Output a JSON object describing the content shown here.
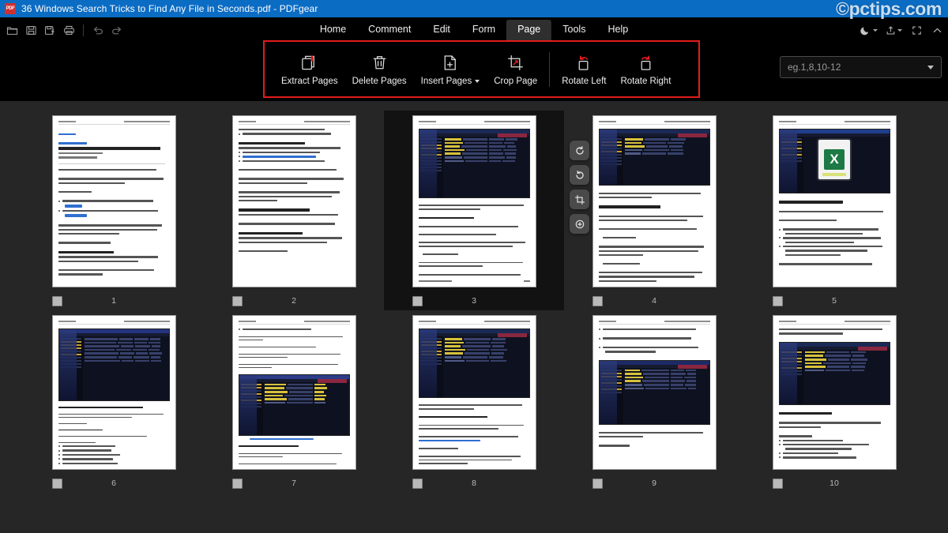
{
  "window": {
    "title": "36 Windows Search Tricks to Find Any File in Seconds.pdf - PDFgear",
    "app_icon": "pdf-file-icon",
    "titlebar_color": "#0b6cc4"
  },
  "watermark": {
    "text": "©pctips.com"
  },
  "quick_access": {
    "items": [
      {
        "name": "open-file-icon",
        "label": "Open"
      },
      {
        "name": "save-icon",
        "label": "Save"
      },
      {
        "name": "save-as-icon",
        "label": "Save As"
      },
      {
        "name": "print-icon",
        "label": "Print"
      },
      {
        "name": "undo-icon",
        "label": "Undo"
      },
      {
        "name": "redo-icon",
        "label": "Redo"
      }
    ]
  },
  "menu": {
    "active": "Page",
    "items": [
      {
        "label": "Home"
      },
      {
        "label": "Comment"
      },
      {
        "label": "Edit"
      },
      {
        "label": "Form"
      },
      {
        "label": "Page"
      },
      {
        "label": "Tools"
      },
      {
        "label": "Help"
      }
    ]
  },
  "window_controls": {
    "items": [
      {
        "name": "dark-mode-moon-icon",
        "label": "Dark Mode"
      },
      {
        "name": "share-upload-icon",
        "label": "Share"
      },
      {
        "name": "fullscreen-icon",
        "label": "Fullscreen"
      },
      {
        "name": "collapse-ribbon-chevron-up-icon",
        "label": "Collapse Ribbon"
      }
    ]
  },
  "ribbon": {
    "highlight_color": "#e31c1c",
    "buttons": [
      {
        "label": "Extract Pages",
        "icon": "extract-pages-icon",
        "caret": false
      },
      {
        "label": "Delete Pages",
        "icon": "delete-pages-trash-icon",
        "caret": false
      },
      {
        "label": "Insert Pages",
        "icon": "insert-pages-icon",
        "caret": true
      },
      {
        "label": "Crop Page",
        "icon": "crop-page-icon",
        "caret": false
      },
      {
        "label": "Rotate Left",
        "icon": "rotate-left-icon",
        "caret": false
      },
      {
        "label": "Rotate Right",
        "icon": "rotate-right-icon",
        "caret": false
      }
    ]
  },
  "page_range": {
    "placeholder": "eg.1,8,10-12",
    "value": "",
    "dropdown_icon": "chevron-down-icon"
  },
  "thumbnail_actions": [
    {
      "name": "rotate-left-action-icon",
      "label": "Rotate Left"
    },
    {
      "name": "rotate-right-action-icon",
      "label": "Rotate Right"
    },
    {
      "name": "crop-action-icon",
      "label": "Crop"
    },
    {
      "name": "zoom-in-action-icon",
      "label": "Zoom In"
    }
  ],
  "thumbnails": {
    "selected_page": 3,
    "pages": [
      {
        "number": "1",
        "layout": "title",
        "selected": false
      },
      {
        "number": "2",
        "layout": "text",
        "selected": false
      },
      {
        "number": "3",
        "layout": "shot-top",
        "selected": true
      },
      {
        "number": "4",
        "layout": "shot-top",
        "selected": false
      },
      {
        "number": "5",
        "layout": "shot-excel",
        "selected": false
      },
      {
        "number": "6",
        "layout": "shot-top",
        "selected": false
      },
      {
        "number": "7",
        "layout": "shot-mid",
        "selected": false
      },
      {
        "number": "8",
        "layout": "shot-top",
        "selected": false
      },
      {
        "number": "9",
        "layout": "shot-mid",
        "selected": false
      },
      {
        "number": "10",
        "layout": "shot-top",
        "selected": false
      }
    ]
  },
  "colors": {
    "background": "#262626",
    "toolbar": "#000000",
    "accent_red": "#e31c1c",
    "title_blue": "#0b6cc4"
  }
}
